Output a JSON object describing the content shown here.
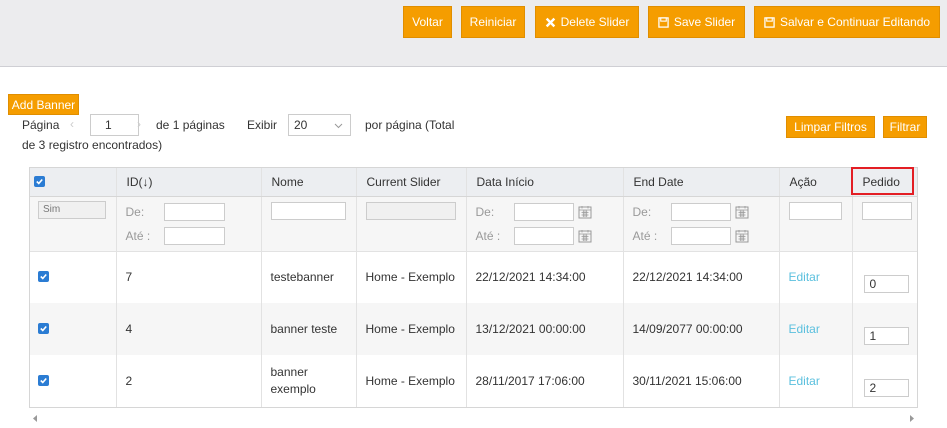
{
  "toolbar": {
    "voltar": "Voltar",
    "reiniciar": "Reiniciar",
    "delete": "Delete Slider",
    "save": "Save Slider",
    "save_continue": "Salvar e Continuar Editando"
  },
  "add_banner": "Add Banner",
  "pager": {
    "page_label": "Página",
    "page_value": "1",
    "of_label": "de",
    "total_pages": "1",
    "pages_label": "páginas",
    "show_label": "Exibir",
    "per_page": "20",
    "per_page_label": "por página (Total",
    "total_line": "de 3 registro encontrados)"
  },
  "filters_buttons": {
    "clear": "Limpar Filtros",
    "filter": "Filtrar"
  },
  "columns": {
    "id": "ID",
    "id_sort": "(↓)",
    "name": "Nome",
    "slider": "Current Slider",
    "start": "Data Início",
    "end": "End Date",
    "action": "Ação",
    "order": "Pedido"
  },
  "filter": {
    "select_value": "Sim",
    "from": "De:",
    "to": "Até :"
  },
  "rows": [
    {
      "id": "7",
      "name": "testebanner",
      "slider": "Home - Exemplo",
      "start": "22/12/2021 14:34:00",
      "end": "22/12/2021 14:34:00",
      "action": "Editar",
      "order": "0"
    },
    {
      "id": "4",
      "name": "banner teste",
      "slider": "Home - Exemplo",
      "start": "13/12/2021 00:00:00",
      "end": "14/09/2077 00:00:00",
      "action": "Editar",
      "order": "1"
    },
    {
      "id": "2",
      "name": "banner exemplo",
      "slider": "Home - Exemplo",
      "start": "28/11/2017 17:06:00",
      "end": "30/11/2021 15:06:00",
      "action": "Editar",
      "order": "2"
    }
  ],
  "colors": {
    "accent": "#f59d00",
    "link": "#5bc0de",
    "highlight": "#e31e24",
    "checkbox": "#2b7cd3"
  }
}
